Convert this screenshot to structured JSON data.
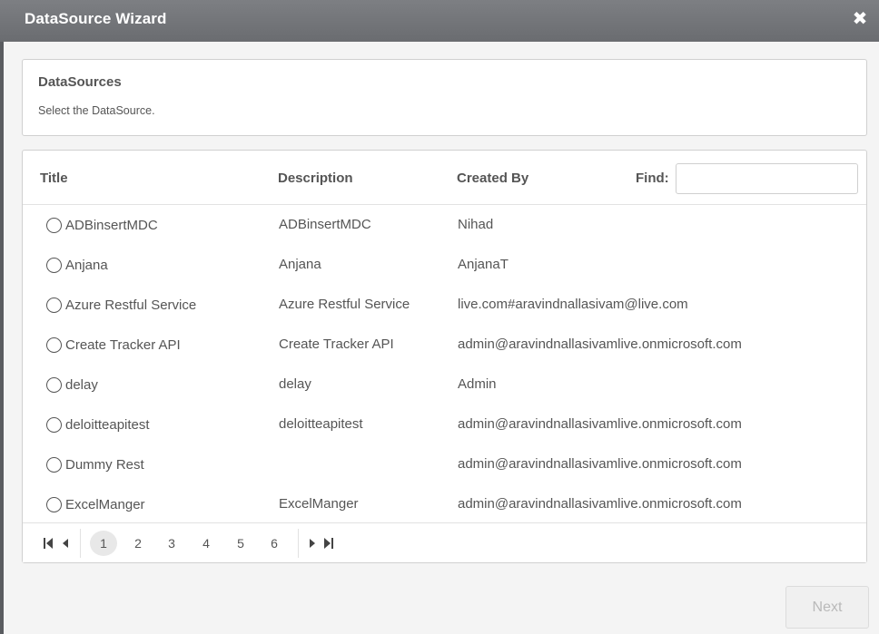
{
  "window": {
    "title": "DataSource Wizard"
  },
  "info": {
    "heading": "DataSources",
    "subtitle": "Select the DataSource."
  },
  "table": {
    "columns": [
      "Title",
      "Description",
      "Created By"
    ],
    "find_label": "Find:",
    "find_value": "",
    "rows": [
      {
        "title": "ADBinsertMDC",
        "description": "ADBinsertMDC",
        "created_by": "Nihad"
      },
      {
        "title": "Anjana",
        "description": "Anjana",
        "created_by": "AnjanaT"
      },
      {
        "title": "Azure Restful Service",
        "description": "Azure Restful Service",
        "created_by": "live.com#aravindnallasivam@live.com"
      },
      {
        "title": "Create Tracker API",
        "description": "Create Tracker API",
        "created_by": "admin@aravindnallasivamlive.onmicrosoft.com"
      },
      {
        "title": "delay",
        "description": "delay",
        "created_by": "Admin"
      },
      {
        "title": "deloitteapitest",
        "description": "deloitteapitest",
        "created_by": "admin@aravindnallasivamlive.onmicrosoft.com"
      },
      {
        "title": "Dummy Rest",
        "description": "",
        "created_by": "admin@aravindnallasivamlive.onmicrosoft.com"
      },
      {
        "title": "ExcelManger",
        "description": "ExcelManger",
        "created_by": "admin@aravindnallasivamlive.onmicrosoft.com"
      }
    ]
  },
  "pager": {
    "pages": [
      "1",
      "2",
      "3",
      "4",
      "5",
      "6"
    ],
    "current": "1"
  },
  "footer": {
    "next_label": "Next"
  },
  "icons": {
    "close": "close-icon",
    "first": "first-page-icon",
    "prev": "prev-page-icon",
    "next": "next-page-icon",
    "last": "last-page-icon"
  }
}
